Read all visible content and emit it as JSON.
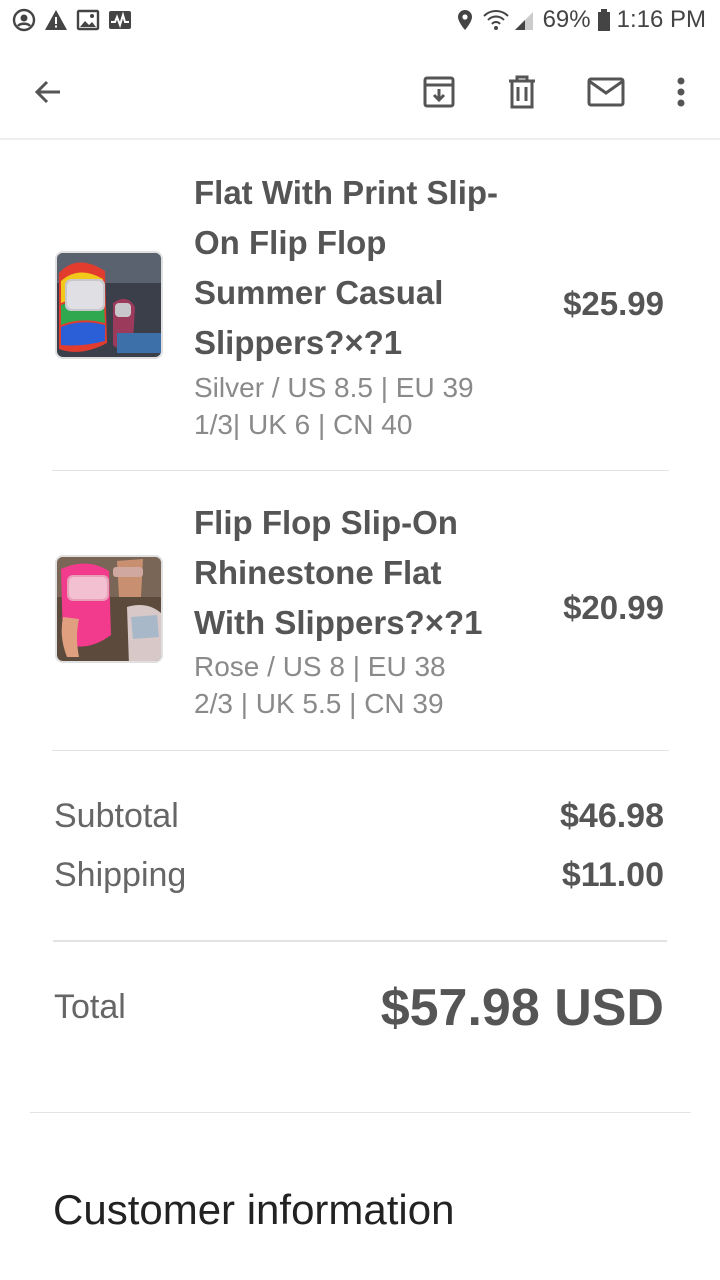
{
  "status_bar": {
    "battery": "69%",
    "time": "1:16 PM",
    "icons": [
      "account-circle-icon",
      "warning-icon",
      "image-icon",
      "activity-icon",
      "location-icon",
      "wifi-icon",
      "signal-icon",
      "battery-icon"
    ]
  },
  "app_bar": {
    "icons": [
      "back-arrow-icon",
      "archive-icon",
      "delete-icon",
      "mail-icon",
      "more-vert-icon"
    ]
  },
  "items": [
    {
      "title_lines": [
        "Flat With Print Slip-",
        "On Flip Flop",
        "Summer Casual",
        "Slippers?×?1"
      ],
      "variant_lines": [
        "Silver / US 8.5 | EU 39",
        "1/3| UK 6 | CN 40"
      ],
      "price": "$25.99"
    },
    {
      "title_lines": [
        "Flip Flop Slip-On",
        "Rhinestone Flat",
        "With Slippers?×?1"
      ],
      "variant_lines": [
        "Rose / US 8 | EU 38",
        "2/3 | UK 5.5 | CN 39"
      ],
      "price": "$20.99"
    }
  ],
  "summary": {
    "subtotal_label": "Subtotal",
    "subtotal_value": "$46.98",
    "shipping_label": "Shipping",
    "shipping_value": "$11.00",
    "total_label": "Total",
    "total_value": "$57.98 USD"
  },
  "customer_info_title": "Customer information"
}
